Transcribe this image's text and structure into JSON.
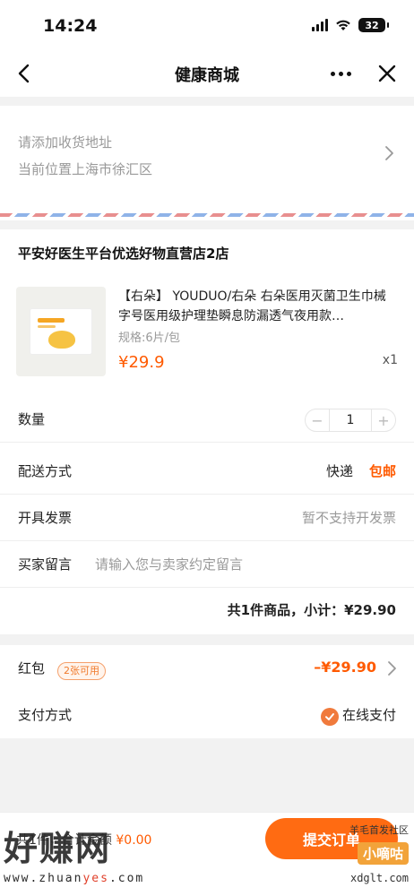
{
  "status_bar": {
    "time": "14:24",
    "battery": "32"
  },
  "nav": {
    "title": "健康商城"
  },
  "address": {
    "prompt": "请添加收货地址",
    "location": "当前位置上海市徐汇区"
  },
  "store": {
    "name": "平安好医生平台优选好物直营店2店"
  },
  "product": {
    "title": "【右朵】 YOUDUO/右朵 右朵医用灭菌卫生巾械字号医用级护理垫瞬息防漏透气夜用款…",
    "spec": "规格:6片/包",
    "price": "¥29.9",
    "qty_text": "x1"
  },
  "order": {
    "quantity_label": "数量",
    "quantity_value": "1",
    "minus": "−",
    "plus": "+",
    "delivery_label": "配送方式",
    "delivery_method": "快递",
    "delivery_fee": "包邮",
    "invoice_label": "开具发票",
    "invoice_value": "暂不支持开发票",
    "remark_label": "买家留言",
    "remark_placeholder": "请输入您与卖家约定留言",
    "subtotal": "共1件商品，小计：¥29.90"
  },
  "payment": {
    "hongbao_label": "红包",
    "hongbao_badge": "2张可用",
    "hongbao_value": "–¥29.90",
    "pay_label": "支付方式",
    "pay_value": "在线支付"
  },
  "bottom": {
    "summary_prefix": "共1件，合计金额",
    "summary_amount": "¥0.00",
    "submit": "提交订单"
  },
  "watermark": {
    "big": "好赚网",
    "url_a": "www.zhuan",
    "url_b": "yes",
    "url_c": ".com",
    "right_top": "羊毛首发社区",
    "right_badge": "小嘀咕",
    "right_url": "xdglt.com"
  },
  "colors": {
    "accent": "#ff5a00",
    "button": "#ff6b12"
  }
}
